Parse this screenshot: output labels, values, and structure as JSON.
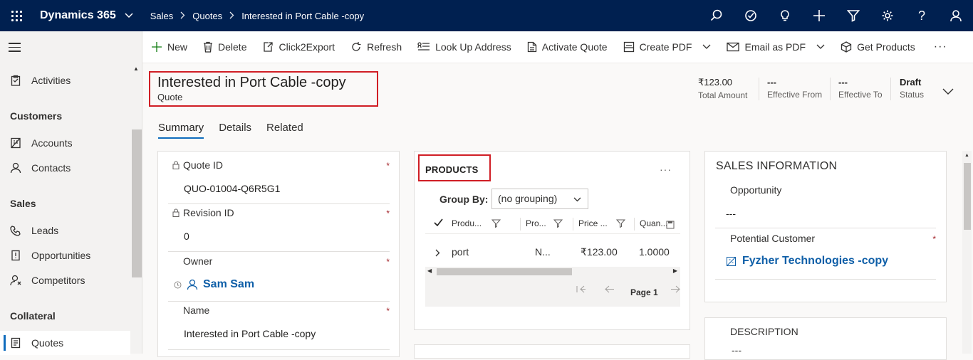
{
  "topbar": {
    "app_name": "Dynamics 365",
    "breadcrumb": [
      "Sales",
      "Quotes",
      "Interested in Port Cable -copy"
    ],
    "icons": [
      "search-icon",
      "task-icon",
      "lightbulb-icon",
      "plus-icon",
      "filter-icon",
      "gear-icon",
      "help-icon",
      "user-icon"
    ],
    "help_glyph": "?"
  },
  "sidebar": {
    "items": [
      {
        "label": "Activities",
        "icon": "clipboard-icon"
      },
      {
        "label": "Customers",
        "type": "header"
      },
      {
        "label": "Accounts",
        "icon": "building-icon"
      },
      {
        "label": "Contacts",
        "icon": "person-icon"
      },
      {
        "label": "Sales",
        "type": "header"
      },
      {
        "label": "Leads",
        "icon": "phone-icon"
      },
      {
        "label": "Opportunities",
        "icon": "opportunity-icon"
      },
      {
        "label": "Competitors",
        "icon": "competitor-icon"
      },
      {
        "label": "Collateral",
        "type": "header"
      },
      {
        "label": "Quotes",
        "icon": "quote-icon",
        "active": true
      }
    ]
  },
  "commands": {
    "new": "New",
    "delete": "Delete",
    "click2export": "Click2Export",
    "refresh": "Refresh",
    "lookup": "Look Up Address",
    "activate": "Activate Quote",
    "create_pdf": "Create PDF",
    "email_pdf": "Email as PDF",
    "get_products": "Get Products",
    "more": "···"
  },
  "header": {
    "title": "Interested in Port Cable -copy",
    "entity": "Quote",
    "fields": [
      {
        "value": "₹123.00",
        "label": "Total Amount"
      },
      {
        "value": "---",
        "label": "Effective From"
      },
      {
        "value": "---",
        "label": "Effective To"
      },
      {
        "value": "Draft",
        "label": "Status"
      }
    ]
  },
  "tabs": [
    "Summary",
    "Details",
    "Related"
  ],
  "summary": {
    "quote_id_label": "Quote ID",
    "quote_id": "QUO-01004-Q6R5G1",
    "revision_label": "Revision ID",
    "revision": "0",
    "owner_label": "Owner",
    "owner": "Sam Sam",
    "name_label": "Name",
    "name": "Interested in Port Cable -copy",
    "required_mark": "*"
  },
  "products": {
    "title": "PRODUCTS",
    "more": "···",
    "group_by_label": "Group By:",
    "group_by_value": "(no grouping)",
    "columns": [
      "Produ...",
      "Pro...",
      "Price ...",
      "Quan..."
    ],
    "row": {
      "product": "port",
      "col2": "N...",
      "price": "₹123.00",
      "qty": "1.0000"
    },
    "page": "Page 1"
  },
  "sales_info": {
    "title": "SALES INFORMATION",
    "opportunity_label": "Opportunity",
    "opportunity": "---",
    "customer_label": "Potential Customer",
    "customer": "Fyzher Technologies -copy"
  },
  "description": {
    "label": "DESCRIPTION",
    "value": "---"
  }
}
